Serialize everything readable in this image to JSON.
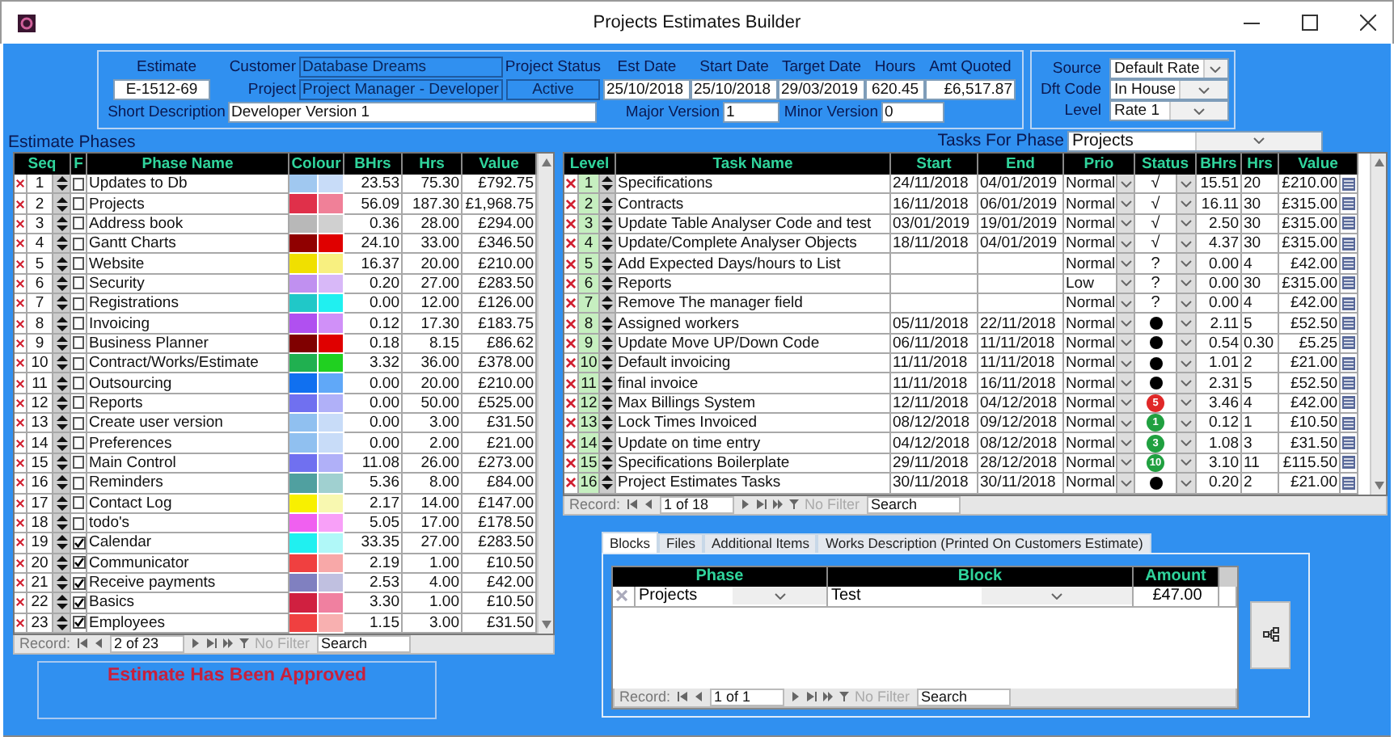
{
  "window": {
    "title": "Projects Estimates Builder"
  },
  "estimate": {
    "estimate_label": "Estimate",
    "number": "E-1512-69",
    "customer_label": "Customer",
    "customer": "Database Dreams",
    "project_label": "Project",
    "project": "Project Manager - Developer",
    "status_label": "Project Status",
    "status": "Active",
    "short_description_label": "Short Description",
    "short_description": "Developer Version 1",
    "est_date_label": "Est Date",
    "est_date": "25/10/2018",
    "start_date_label": "Start Date",
    "start_date": "25/10/2018",
    "target_date_label": "Target Date",
    "target_date": "29/03/2019",
    "hours_label": "Hours",
    "hours": "620.45",
    "amt_quoted_label": "Amt Quoted",
    "amt_quoted": "£6,517.87",
    "major_version_label": "Major Version",
    "major_version": "1",
    "minor_version_label": "Minor Version",
    "minor_version": "0"
  },
  "rates": {
    "source_label": "Source",
    "source": "Default Rate",
    "dft_code_label": "Dft Code",
    "dft_code": "In House",
    "level_label": "Level",
    "level_value": "Rate 1"
  },
  "phases": {
    "title": "Estimate Phases",
    "columns": [
      "Seq",
      "F",
      "Phase Name",
      "Colour",
      "BHrs",
      "Hrs",
      "Value"
    ],
    "rows": [
      {
        "seq": "1",
        "flag": false,
        "name": "Updates to Db",
        "swatches": [
          {
            "color": "#a0c8f0"
          },
          {
            "color": "#c8dcf8"
          }
        ],
        "bhrs": "23.53",
        "hrs": "75.30",
        "value": "£792.75"
      },
      {
        "seq": "2",
        "flag": false,
        "name": "Projects",
        "swatches": [
          {
            "color": "#e0304a"
          },
          {
            "color": "#f08098"
          }
        ],
        "bhrs": "56.09",
        "hrs": "187.30",
        "value": "£1,968.75"
      },
      {
        "seq": "3",
        "flag": false,
        "name": "Address book",
        "swatches": [
          {
            "color": "#b8b8b8"
          },
          {
            "color": "#d0d0d0"
          }
        ],
        "bhrs": "0.36",
        "hrs": "28.00",
        "value": "£294.00"
      },
      {
        "seq": "4",
        "flag": false,
        "name": "Gantt Charts",
        "swatches": [
          {
            "color": "#900000"
          },
          {
            "color": "#e00000"
          }
        ],
        "bhrs": "24.10",
        "hrs": "33.00",
        "value": "£346.50"
      },
      {
        "seq": "5",
        "flag": false,
        "name": "Website",
        "swatches": [
          {
            "color": "#f0e000"
          },
          {
            "color": "#f8f080"
          }
        ],
        "bhrs": "16.37",
        "hrs": "20.00",
        "value": "£210.00"
      },
      {
        "seq": "6",
        "flag": false,
        "name": "Security",
        "swatches": [
          {
            "color": "#c090f0"
          },
          {
            "color": "#d8b8f8"
          }
        ],
        "bhrs": "0.20",
        "hrs": "27.00",
        "value": "£283.50"
      },
      {
        "seq": "7",
        "flag": false,
        "name": "Registrations",
        "swatches": [
          {
            "color": "#20c8c8"
          },
          {
            "color": "#20f0f0"
          }
        ],
        "bhrs": "0.00",
        "hrs": "12.00",
        "value": "£126.00"
      },
      {
        "seq": "8",
        "flag": false,
        "name": "Invoicing",
        "swatches": [
          {
            "color": "#b050f0"
          },
          {
            "color": "#d090f8"
          }
        ],
        "bhrs": "0.12",
        "hrs": "17.30",
        "value": "£183.75"
      },
      {
        "seq": "9",
        "flag": false,
        "name": "Business Planner",
        "swatches": [
          {
            "color": "#800000"
          },
          {
            "color": "#e00000"
          }
        ],
        "bhrs": "0.18",
        "hrs": "8.15",
        "value": "£86.62"
      },
      {
        "seq": "10",
        "flag": false,
        "name": "Contract/Works/Estimate",
        "swatches": [
          {
            "color": "#20b050"
          },
          {
            "color": "#20d020"
          }
        ],
        "bhrs": "3.32",
        "hrs": "36.00",
        "value": "£378.00"
      },
      {
        "seq": "11",
        "flag": false,
        "name": "Outsourcing",
        "swatches": [
          {
            "color": "#1070f0"
          },
          {
            "color": "#60a8f8"
          }
        ],
        "bhrs": "0.00",
        "hrs": "20.00",
        "value": "£210.00"
      },
      {
        "seq": "12",
        "flag": false,
        "name": "Reports",
        "swatches": [
          {
            "color": "#7070f0"
          },
          {
            "color": "#b0b0f8"
          }
        ],
        "bhrs": "0.00",
        "hrs": "50.00",
        "value": "£525.00"
      },
      {
        "seq": "13",
        "flag": false,
        "name": "Create user version",
        "swatches": [
          {
            "color": "#90c0f0"
          },
          {
            "color": "#c8dcf8"
          }
        ],
        "bhrs": "0.00",
        "hrs": "3.00",
        "value": "£31.50"
      },
      {
        "seq": "14",
        "flag": false,
        "name": "Preferences",
        "swatches": [
          {
            "color": "#90c0f0"
          },
          {
            "color": "#c8dcf8"
          }
        ],
        "bhrs": "0.00",
        "hrs": "2.00",
        "value": "£21.00"
      },
      {
        "seq": "15",
        "flag": false,
        "name": "Main Control",
        "swatches": [
          {
            "color": "#7070f0"
          },
          {
            "color": "#b0b0f8"
          }
        ],
        "bhrs": "11.08",
        "hrs": "26.00",
        "value": "£273.00"
      },
      {
        "seq": "16",
        "flag": false,
        "name": "Reminders",
        "swatches": [
          {
            "color": "#50a0a0"
          },
          {
            "color": "#a0d0d0"
          }
        ],
        "bhrs": "5.36",
        "hrs": "8.00",
        "value": "£84.00"
      },
      {
        "seq": "17",
        "flag": false,
        "name": "Contact Log",
        "swatches": [
          {
            "color": "#f8f000"
          },
          {
            "color": "#f8f8b0"
          }
        ],
        "bhrs": "2.17",
        "hrs": "14.00",
        "value": "£147.00"
      },
      {
        "seq": "18",
        "flag": false,
        "name": "todo's",
        "swatches": [
          {
            "color": "#f060f0"
          },
          {
            "color": "#f8a0f8"
          }
        ],
        "bhrs": "5.05",
        "hrs": "17.00",
        "value": "£178.50"
      },
      {
        "seq": "19",
        "flag": true,
        "name": "Calendar",
        "swatches": [
          {
            "color": "#20f0f0"
          },
          {
            "color": "#b0f8f8"
          }
        ],
        "bhrs": "33.35",
        "hrs": "27.00",
        "value": "£283.50"
      },
      {
        "seq": "20",
        "flag": true,
        "name": "Communicator",
        "swatches": [
          {
            "color": "#f04040"
          },
          {
            "color": "#f8a8a8"
          }
        ],
        "bhrs": "2.19",
        "hrs": "1.00",
        "value": "£10.50"
      },
      {
        "seq": "21",
        "flag": true,
        "name": "Receive payments",
        "swatches": [
          {
            "color": "#8080c0"
          },
          {
            "color": "#c0c0e0"
          }
        ],
        "bhrs": "2.53",
        "hrs": "4.00",
        "value": "£42.00"
      },
      {
        "seq": "22",
        "flag": true,
        "name": "Basics",
        "swatches": [
          {
            "color": "#d02040"
          },
          {
            "color": "#f080a0"
          }
        ],
        "bhrs": "3.30",
        "hrs": "1.00",
        "value": "£10.50"
      },
      {
        "seq": "23",
        "flag": true,
        "name": "Employees",
        "swatches": [
          {
            "color": "#f04040"
          },
          {
            "color": "#f8b0b0"
          }
        ],
        "bhrs": "1.15",
        "hrs": "3.00",
        "value": "£31.50"
      }
    ],
    "record_nav": {
      "label": "Record:",
      "position": "2 of 23",
      "filter": "No Filter",
      "search_placeholder": "Search"
    }
  },
  "approval": {
    "message": "Estimate Has Been Approved"
  },
  "tasks": {
    "phase_label": "Tasks For Phase",
    "phase": "Projects",
    "columns": [
      "Level",
      "Task Name",
      "Start",
      "End",
      "Prio",
      "Status",
      "BHrs",
      "Hrs",
      "Value"
    ],
    "rows": [
      {
        "level": "1",
        "name": "Specifications",
        "start": "24/11/2018",
        "end": "04/01/2019",
        "priority": "Normal",
        "status": {
          "kind": "check",
          "text": "√"
        },
        "bhrs": "15.51",
        "hrs": "20",
        "value": "£210.00"
      },
      {
        "level": "2",
        "name": "Contracts",
        "start": "16/11/2018",
        "end": "06/01/2019",
        "priority": "Normal",
        "status": {
          "kind": "check",
          "text": "√"
        },
        "bhrs": "16.11",
        "hrs": "30",
        "value": "£315.00"
      },
      {
        "level": "3",
        "name": "Update Table Analyser Code and test",
        "start": "03/01/2019",
        "end": "19/01/2019",
        "priority": "Normal",
        "status": {
          "kind": "check",
          "text": "√"
        },
        "bhrs": "2.50",
        "hrs": "30",
        "value": "£315.00"
      },
      {
        "level": "4",
        "name": "Update/Complete Analyser Objects",
        "start": "18/11/2018",
        "end": "04/01/2019",
        "priority": "Normal",
        "status": {
          "kind": "check",
          "text": "√"
        },
        "bhrs": "4.37",
        "hrs": "30",
        "value": "£315.00"
      },
      {
        "level": "5",
        "name": "Add Expected Days/hours to List",
        "priority": "Normal",
        "status": {
          "kind": "question",
          "text": "?"
        },
        "bhrs": "0.00",
        "hrs": "4",
        "value": "£42.00"
      },
      {
        "level": "6",
        "name": "Reports",
        "priority": "Low",
        "status": {
          "kind": "question",
          "text": "?"
        },
        "bhrs": "0.00",
        "hrs": "30",
        "value": "£315.00"
      },
      {
        "level": "7",
        "name": "Remove The manager field",
        "priority": "Normal",
        "status": {
          "kind": "question",
          "text": "?"
        },
        "bhrs": "0.00",
        "hrs": "4",
        "value": "£42.00"
      },
      {
        "level": "8",
        "name": "Assigned workers",
        "start": "05/11/2018",
        "end": "22/11/2018",
        "priority": "Normal",
        "status": {
          "kind": "dot"
        },
        "bhrs": "2.11",
        "hrs": "5",
        "value": "£52.50"
      },
      {
        "level": "9",
        "name": "Update Move UP/Down Code",
        "start": "06/11/2018",
        "end": "11/11/2018",
        "priority": "Normal",
        "status": {
          "kind": "dot"
        },
        "bhrs": "0.54",
        "hrs": "0.30",
        "value": "£5.25"
      },
      {
        "level": "10",
        "name": "Default invoicing",
        "start": "11/11/2018",
        "end": "11/11/2018",
        "priority": "Normal",
        "status": {
          "kind": "dot"
        },
        "bhrs": "1.01",
        "hrs": "2",
        "value": "£21.00"
      },
      {
        "level": "11",
        "name": "final invoice",
        "start": "11/11/2018",
        "end": "16/11/2018",
        "priority": "Normal",
        "status": {
          "kind": "dot"
        },
        "bhrs": "2.31",
        "hrs": "5",
        "value": "£52.50"
      },
      {
        "level": "12",
        "name": "Max Billings System",
        "start": "12/11/2018",
        "end": "04/12/2018",
        "priority": "Normal",
        "status": {
          "kind": "badge",
          "text": "5",
          "color": "#e02828"
        },
        "bhrs": "3.46",
        "hrs": "4",
        "value": "£42.00"
      },
      {
        "level": "13",
        "name": "Lock Times Invoiced",
        "start": "08/12/2018",
        "end": "09/12/2018",
        "priority": "Normal",
        "status": {
          "kind": "badge",
          "text": "1",
          "color": "#20a040"
        },
        "bhrs": "0.12",
        "hrs": "1",
        "value": "£10.50"
      },
      {
        "level": "14",
        "name": "Update on time entry",
        "start": "04/12/2018",
        "end": "08/12/2018",
        "priority": "Normal",
        "status": {
          "kind": "badge",
          "text": "3",
          "color": "#20a040"
        },
        "bhrs": "1.08",
        "hrs": "3",
        "value": "£31.50"
      },
      {
        "level": "15",
        "name": "Specifications Boilerplate",
        "start": "29/11/2018",
        "end": "28/12/2018",
        "priority": "Normal",
        "status": {
          "kind": "badge",
          "text": "10",
          "color": "#20a040"
        },
        "bhrs": "3.10",
        "hrs": "11",
        "value": "£115.50"
      },
      {
        "level": "16",
        "name": "Project Estimates Tasks",
        "start": "30/11/2018",
        "end": "30/11/2018",
        "priority": "Normal",
        "status": {
          "kind": "dot"
        },
        "bhrs": "0.20",
        "hrs": "2",
        "value": "£21.00"
      }
    ],
    "record_nav": {
      "label": "Record:",
      "position": "1 of 18",
      "filter": "No Filter",
      "search_placeholder": "Search"
    }
  },
  "detail_tabs": {
    "tabs": [
      {
        "label": "Blocks",
        "selected": true
      },
      {
        "label": "Files",
        "selected": false
      },
      {
        "label": "Additional Items",
        "selected": false
      },
      {
        "label": "Works Description (Printed On Customers Estimate)",
        "selected": false
      }
    ],
    "columns": [
      "Phase",
      "Block",
      "Amount"
    ],
    "rows": [
      {
        "phase": "Projects",
        "block": "Test",
        "amount": "£47.00"
      }
    ],
    "record_nav": {
      "label": "Record:",
      "position": "1 of 1",
      "filter": "No Filter",
      "search_placeholder": "Search"
    }
  }
}
